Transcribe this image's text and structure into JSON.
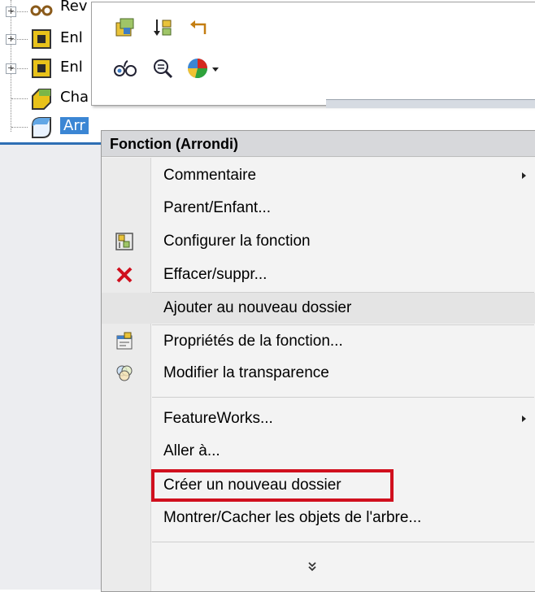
{
  "tree": {
    "items": [
      {
        "label": "Rev",
        "icon": "revolve-icon"
      },
      {
        "label": "Enl",
        "icon": "extrude-cut-icon"
      },
      {
        "label": "Enl",
        "icon": "extrude-cut-icon"
      },
      {
        "label": "Cha",
        "icon": "chamfer-icon"
      },
      {
        "label": "Arr",
        "icon": "fillet-icon"
      }
    ]
  },
  "toolbar": {
    "icons": [
      "edit-feature-icon",
      "rollback-icon",
      "undo-arrow-icon",
      "view-icon",
      "zoom-icon",
      "appearance-icon"
    ]
  },
  "menu": {
    "header": "Fonction (Arrondi)",
    "items": [
      {
        "label": "Commentaire",
        "submenu": true,
        "icon": ""
      },
      {
        "label": "Parent/Enfant...",
        "icon": ""
      },
      {
        "label": "Configurer la fonction",
        "icon": "configure-feature-icon"
      },
      {
        "label": "Effacer/suppr...",
        "icon": "delete-icon"
      },
      {
        "label": "Ajouter au nouveau dossier",
        "icon": ""
      },
      {
        "label": "Propriétés de la fonction...",
        "icon": "properties-icon"
      },
      {
        "label": "Modifier la transparence",
        "icon": "transparency-icon"
      },
      {
        "label": "FeatureWorks...",
        "submenu": true,
        "icon": ""
      },
      {
        "label": "Aller à...",
        "icon": ""
      },
      {
        "label": "Créer un nouveau dossier",
        "icon": ""
      },
      {
        "label": "Montrer/Cacher les objets de l'arbre...",
        "icon": ""
      }
    ],
    "expand": "»"
  },
  "colors": {
    "highlight": "#d0101e",
    "selection": "#3b86d4"
  }
}
